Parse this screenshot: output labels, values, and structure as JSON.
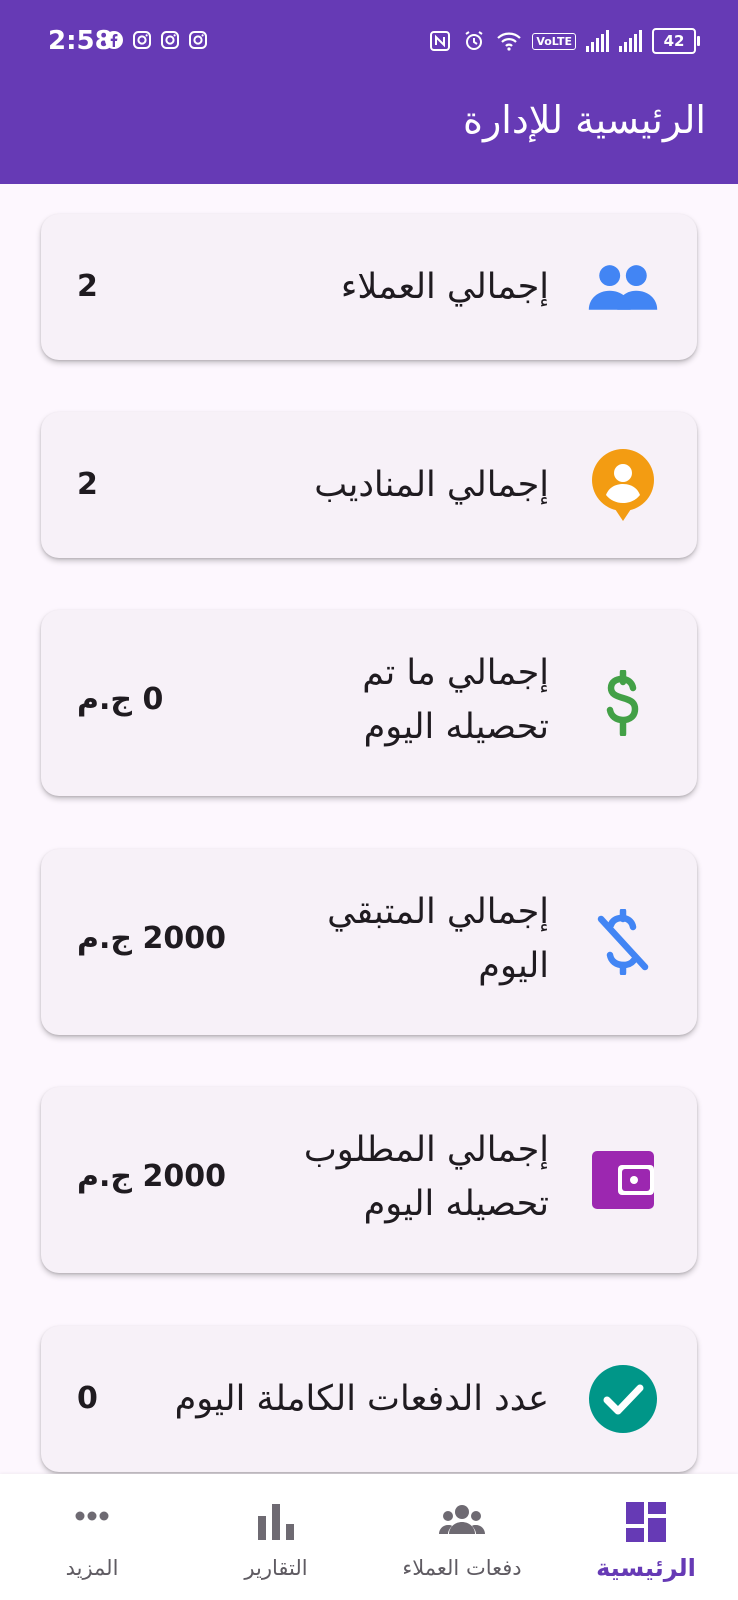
{
  "status_bar": {
    "time": "2:58",
    "left_icons": [
      "facebook-icon",
      "instagram-icon",
      "instagram-icon",
      "instagram-icon"
    ],
    "right_icons": [
      "nfc-icon",
      "alarm-icon",
      "wifi-icon",
      "volte-icon",
      "signal-icon",
      "signal-icon"
    ],
    "volte": "VoLTE",
    "battery": "42"
  },
  "app_bar": {
    "title": "الرئيسية للإدارة",
    "color": "#663ab5"
  },
  "cards": [
    {
      "label": "إجمالي العملاء",
      "value": "2",
      "icon": "people-icon",
      "icon_color": "#4285f4"
    },
    {
      "label": "إجمالي المناديب",
      "value": "2",
      "icon": "person-pin-icon",
      "icon_color": "#f39c12"
    },
    {
      "label": "إجمالي ما تم تحصيله اليوم",
      "value": "0 ج.م",
      "icon": "dollar-icon",
      "icon_color": "#43a047"
    },
    {
      "label": "إجمالي المتبقي اليوم",
      "value": "2000 ج.م",
      "icon": "money-off-icon",
      "icon_color": "#4285f4"
    },
    {
      "label": "إجمالي المطلوب تحصيله اليوم",
      "value": "2000 ج.م",
      "icon": "wallet-icon",
      "icon_color": "#9c27b0"
    },
    {
      "label": "عدد الدفعات الكاملة اليوم",
      "value": "0",
      "icon": "check-circle-icon",
      "icon_color": "#009688"
    }
  ],
  "bottom_nav": {
    "items": [
      {
        "label": "الرئيسية",
        "icon": "dashboard-icon",
        "active": true
      },
      {
        "label": "دفعات العملاء",
        "icon": "group-icon",
        "active": false
      },
      {
        "label": "التقارير",
        "icon": "bar-chart-icon",
        "active": false
      },
      {
        "label": "المزيد",
        "icon": "more-horiz-icon",
        "active": false
      }
    ],
    "active_color": "#663ab5"
  }
}
